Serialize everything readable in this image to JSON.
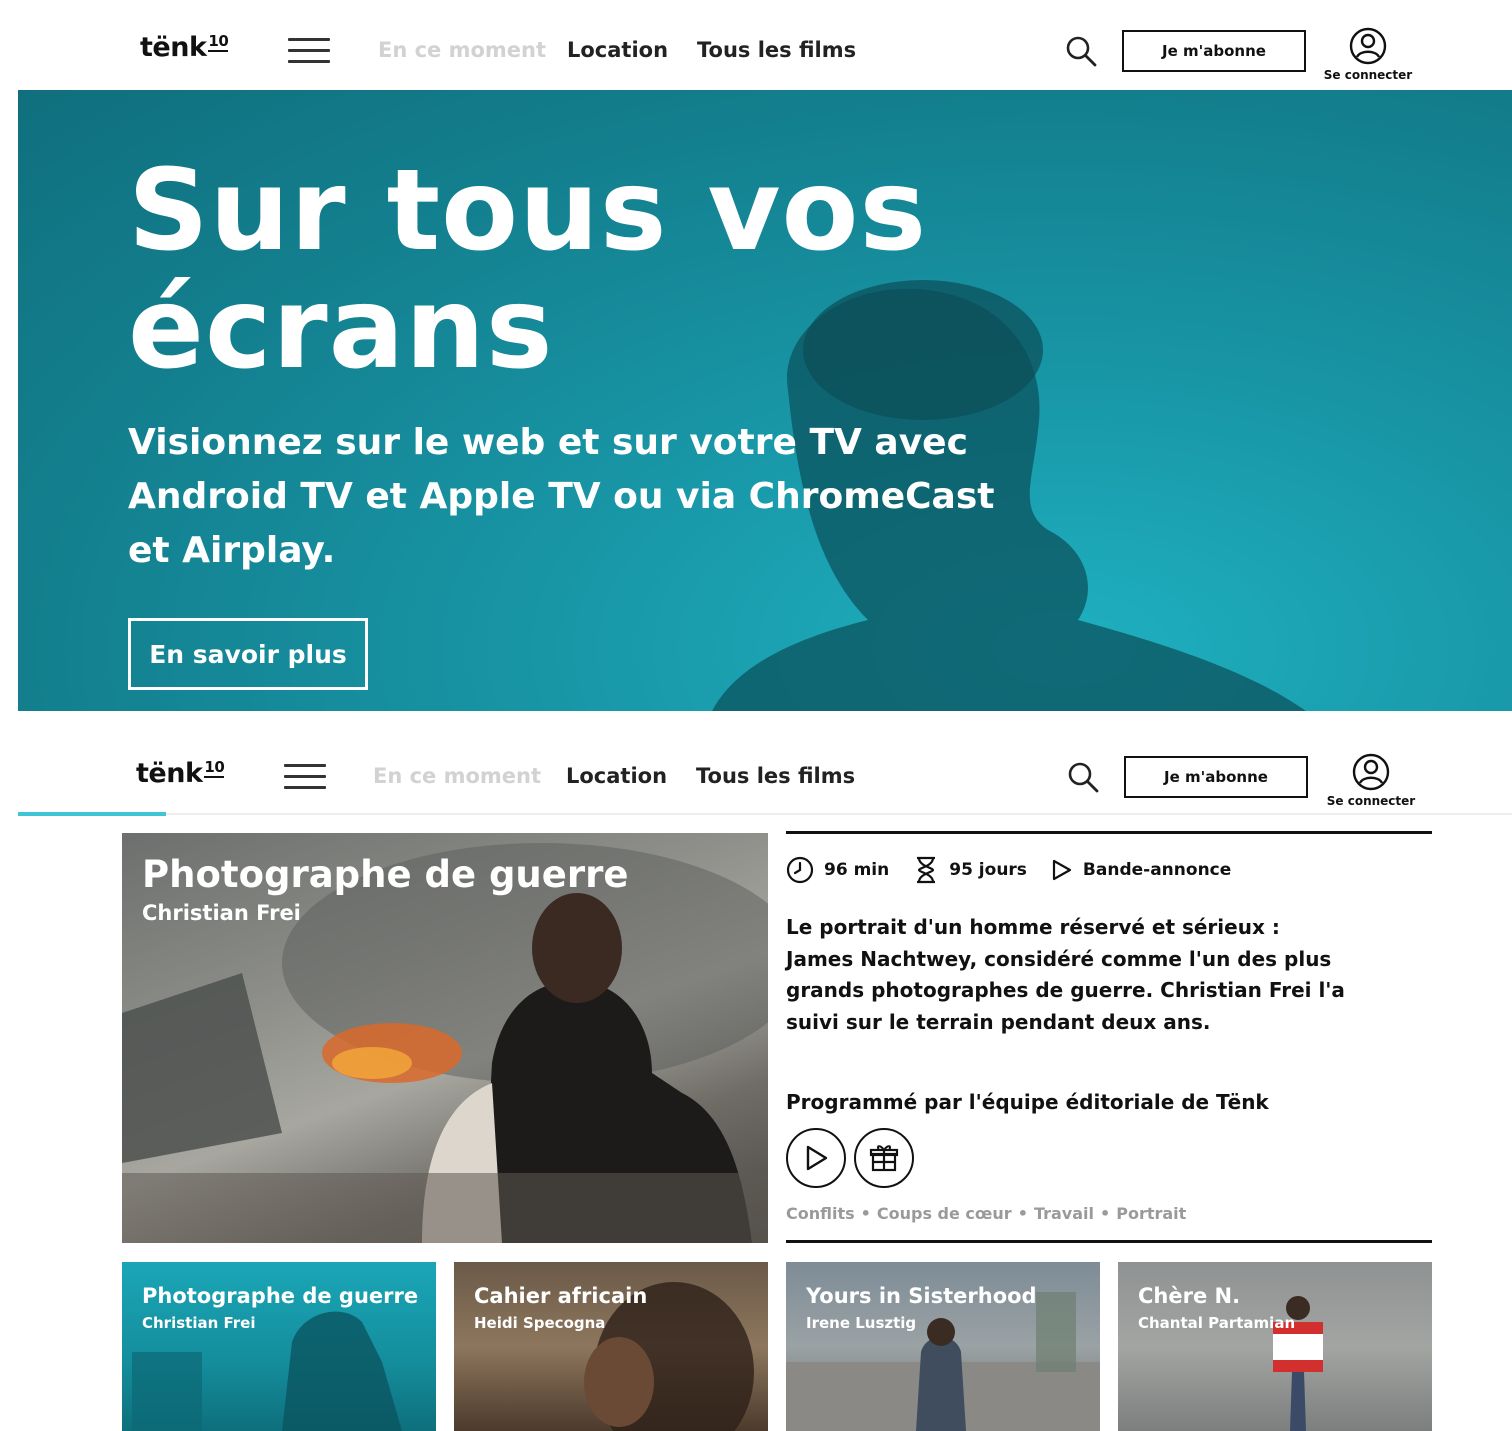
{
  "header": {
    "logo_text": "tënk",
    "logo_badge": "10",
    "nav": [
      "En ce moment",
      "Location",
      "Tous les films"
    ],
    "subscribe_label": "Je m'abonne",
    "account_label": "Se connecter"
  },
  "hero": {
    "title": "Sur tous vos écrans",
    "subtitle": "Visionnez sur le web et sur votre TV avec Android TV et Apple TV ou via ChromeCast et Airplay.",
    "cta_label": "En savoir plus"
  },
  "carousel": {
    "active_index_fraction": 0.1
  },
  "feature": {
    "title": "Photographe de guerre",
    "author": "Christian Frei",
    "duration": "96 min",
    "availability": "95 jours",
    "trailer_label": "Bande-annonce",
    "description": "Le portrait d'un homme réservé et sérieux : James Nachtwey, considéré comme l'un des plus grands photographes de guerre. Christian Frei l'a suivi sur le terrain pendant deux ans.",
    "programmed_by": "Programmé par l'équipe éditoriale de Tënk",
    "tags": [
      "Conflits",
      "Coups de cœur",
      "Travail",
      "Portrait"
    ],
    "tag_separator": "•"
  },
  "thumbnails": [
    {
      "title": "Photographe de guerre",
      "author": "Christian Frei"
    },
    {
      "title": "Cahier africain",
      "author": "Heidi Specogna"
    },
    {
      "title": "Yours in Sisterhood",
      "author": "Irene Lusztig"
    },
    {
      "title": "Chère N.",
      "author": "Chantal Partamian"
    }
  ],
  "colors": {
    "hero_teal": "#137f8e",
    "accent_cyan": "#3ec5d6",
    "muted_nav": "#d2d2d2",
    "tag_gray": "#9a9a9a"
  },
  "icons": [
    "menu-icon",
    "search-icon",
    "user-icon",
    "clock-icon",
    "hourglass-icon",
    "play-icon",
    "gift-icon"
  ]
}
